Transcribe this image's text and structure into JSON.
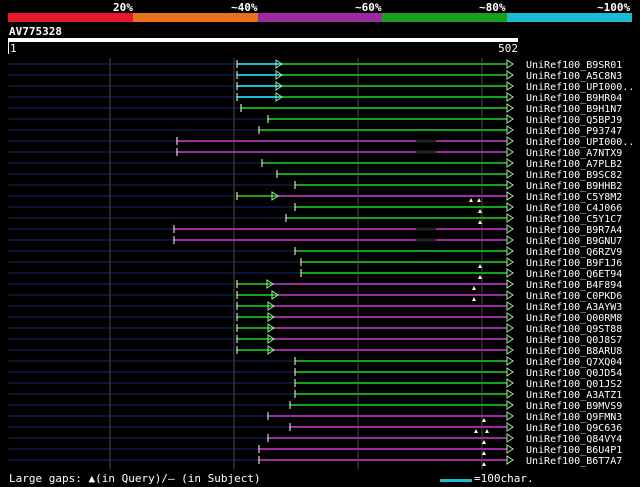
{
  "legend": {
    "labels": [
      "20%",
      "~40%",
      "~60%",
      "~80%",
      "~100%"
    ],
    "colors": [
      "#e6162b",
      "#e8711b",
      "#9c2aa0",
      "#18a01c",
      "#19bcd2"
    ]
  },
  "query": {
    "name": "AV775328",
    "start": "1",
    "end": "502"
  },
  "footer": {
    "gaps_text": "Large gaps: ▲(in Query)/– (in Subject)",
    "scale_text": "=100char."
  },
  "hits": [
    {
      "label": "UniRef100_B9SR01",
      "color": "#18a01c",
      "start": 237,
      "end": 513,
      "seg_color": "#19bcd2",
      "seg_end": 281,
      "ticks": [],
      "gaps": []
    },
    {
      "label": "UniRef100_A5C8N3",
      "color": "#18a01c",
      "start": 237,
      "end": 513,
      "seg_color": "#19bcd2",
      "seg_end": 281,
      "ticks": [],
      "gaps": []
    },
    {
      "label": "UniRef100_UPI000..",
      "color": "#18a01c",
      "start": 237,
      "end": 513,
      "seg_color": "#19bcd2",
      "seg_end": 281,
      "ticks": [],
      "gaps": []
    },
    {
      "label": "UniRef100_B9HR04",
      "color": "#18a01c",
      "start": 237,
      "end": 513,
      "seg_color": "#19bcd2",
      "seg_end": 281,
      "ticks": [],
      "gaps": []
    },
    {
      "label": "UniRef100_B9H1N7",
      "color": "#18a01c",
      "start": 241,
      "end": 513,
      "seg_color": "",
      "seg_end": 0,
      "ticks": [],
      "gaps": []
    },
    {
      "label": "UniRef100_Q5BPJ9",
      "color": "#18a01c",
      "start": 268,
      "end": 513,
      "seg_color": "",
      "seg_end": 0,
      "ticks": [],
      "gaps": []
    },
    {
      "label": "UniRef100_P93747",
      "color": "#18a01c",
      "start": 259,
      "end": 513,
      "seg_color": "",
      "seg_end": 0,
      "ticks": [],
      "gaps": []
    },
    {
      "label": "UniRef100_UPI000..",
      "color": "#9c2aa0",
      "start": 177,
      "end": 513,
      "seg_color": "",
      "seg_end": 0,
      "ticks": [],
      "gaps": [
        [
          416,
          436
        ]
      ]
    },
    {
      "label": "UniRef100_A7NTX9",
      "color": "#9c2aa0",
      "start": 177,
      "end": 513,
      "seg_color": "",
      "seg_end": 0,
      "ticks": [],
      "gaps": [
        [
          416,
          436
        ]
      ]
    },
    {
      "label": "UniRef100_A7PLB2",
      "color": "#18a01c",
      "start": 262,
      "end": 513,
      "seg_color": "",
      "seg_end": 0,
      "ticks": [],
      "gaps": []
    },
    {
      "label": "UniRef100_B9SC82",
      "color": "#18a01c",
      "start": 277,
      "end": 513,
      "seg_color": "",
      "seg_end": 0,
      "ticks": [],
      "gaps": []
    },
    {
      "label": "UniRef100_B9HHB2",
      "color": "#18a01c",
      "start": 295,
      "end": 513,
      "seg_color": "",
      "seg_end": 0,
      "ticks": [],
      "gaps": []
    },
    {
      "label": "UniRef100_C5Y8M2",
      "color": "#9c2aa0",
      "start": 237,
      "end": 513,
      "seg_color": "#18a01c",
      "seg_end": 277,
      "ticks": [
        471,
        479
      ],
      "gaps": []
    },
    {
      "label": "UniRef100_C4J066",
      "color": "#18a01c",
      "start": 295,
      "end": 513,
      "seg_color": "",
      "seg_end": 0,
      "ticks": [
        480
      ],
      "gaps": []
    },
    {
      "label": "UniRef100_C5Y1C7",
      "color": "#18a01c",
      "start": 286,
      "end": 513,
      "seg_color": "",
      "seg_end": 0,
      "ticks": [
        480
      ],
      "gaps": []
    },
    {
      "label": "UniRef100_B9R7A4",
      "color": "#9c2aa0",
      "start": 174,
      "end": 513,
      "seg_color": "",
      "seg_end": 0,
      "ticks": [],
      "gaps": [
        [
          416,
          436
        ]
      ]
    },
    {
      "label": "UniRef100_B9GNU7",
      "color": "#9c2aa0",
      "start": 174,
      "end": 513,
      "seg_color": "",
      "seg_end": 0,
      "ticks": [],
      "gaps": [
        [
          416,
          436
        ]
      ]
    },
    {
      "label": "UniRef100_Q6RZV9",
      "color": "#18a01c",
      "start": 295,
      "end": 513,
      "seg_color": "",
      "seg_end": 0,
      "ticks": [],
      "gaps": []
    },
    {
      "label": "UniRef100_B9F1J6",
      "color": "#18a01c",
      "start": 301,
      "end": 513,
      "seg_color": "",
      "seg_end": 0,
      "ticks": [
        480
      ],
      "gaps": []
    },
    {
      "label": "UniRef100_Q6ET94",
      "color": "#18a01c",
      "start": 301,
      "end": 513,
      "seg_color": "",
      "seg_end": 0,
      "ticks": [
        480
      ],
      "gaps": []
    },
    {
      "label": "UniRef100_B4F894",
      "color": "#9c2aa0",
      "start": 237,
      "end": 513,
      "seg_color": "#18a01c",
      "seg_end": 272,
      "ticks": [
        474
      ],
      "gaps": []
    },
    {
      "label": "UniRef100_C0PKD6",
      "color": "#9c2aa0",
      "start": 237,
      "end": 513,
      "seg_color": "#18a01c",
      "seg_end": 277,
      "ticks": [
        474
      ],
      "gaps": []
    },
    {
      "label": "UniRef100_A3AYW3",
      "color": "#9c2aa0",
      "start": 237,
      "end": 513,
      "seg_color": "#18a01c",
      "seg_end": 273,
      "ticks": [],
      "gaps": []
    },
    {
      "label": "UniRef100_Q00RM8",
      "color": "#9c2aa0",
      "start": 237,
      "end": 513,
      "seg_color": "#18a01c",
      "seg_end": 273,
      "ticks": [],
      "gaps": []
    },
    {
      "label": "UniRef100_Q9ST88",
      "color": "#9c2aa0",
      "start": 237,
      "end": 513,
      "seg_color": "#18a01c",
      "seg_end": 273,
      "ticks": [],
      "gaps": []
    },
    {
      "label": "UniRef100_Q0J8S7",
      "color": "#9c2aa0",
      "start": 237,
      "end": 513,
      "seg_color": "#18a01c",
      "seg_end": 273,
      "ticks": [],
      "gaps": []
    },
    {
      "label": "UniRef100_B8ARU8",
      "color": "#9c2aa0",
      "start": 237,
      "end": 513,
      "seg_color": "#18a01c",
      "seg_end": 273,
      "ticks": [],
      "gaps": []
    },
    {
      "label": "UniRef100_Q7XQ04",
      "color": "#18a01c",
      "start": 295,
      "end": 513,
      "seg_color": "",
      "seg_end": 0,
      "ticks": [],
      "gaps": []
    },
    {
      "label": "UniRef100_Q0JD54",
      "color": "#18a01c",
      "start": 295,
      "end": 513,
      "seg_color": "",
      "seg_end": 0,
      "ticks": [],
      "gaps": []
    },
    {
      "label": "UniRef100_Q01JS2",
      "color": "#18a01c",
      "start": 295,
      "end": 513,
      "seg_color": "",
      "seg_end": 0,
      "ticks": [],
      "gaps": []
    },
    {
      "label": "UniRef100_A3ATZ1",
      "color": "#18a01c",
      "start": 295,
      "end": 513,
      "seg_color": "",
      "seg_end": 0,
      "ticks": [],
      "gaps": []
    },
    {
      "label": "UniRef100_B9MVS9",
      "color": "#18a01c",
      "start": 290,
      "end": 513,
      "seg_color": "",
      "seg_end": 0,
      "ticks": [],
      "gaps": []
    },
    {
      "label": "UniRef100_Q9FMN3",
      "color": "#9c2aa0",
      "start": 268,
      "end": 513,
      "seg_color": "",
      "seg_end": 0,
      "ticks": [
        484
      ],
      "gaps": []
    },
    {
      "label": "UniRef100_Q9C636",
      "color": "#9c2aa0",
      "start": 290,
      "end": 513,
      "seg_color": "",
      "seg_end": 0,
      "ticks": [
        476,
        487
      ],
      "gaps": []
    },
    {
      "label": "UniRef100_Q84VY4",
      "color": "#9c2aa0",
      "start": 268,
      "end": 513,
      "seg_color": "",
      "seg_end": 0,
      "ticks": [
        484
      ],
      "gaps": []
    },
    {
      "label": "UniRef100_B6U4P1",
      "color": "#9c2aa0",
      "start": 259,
      "end": 513,
      "seg_color": "",
      "seg_end": 0,
      "ticks": [
        484
      ],
      "gaps": []
    },
    {
      "label": "UniRef100_B6T7A7",
      "color": "#9c2aa0",
      "start": 259,
      "end": 513,
      "seg_color": "",
      "seg_end": 0,
      "ticks": [
        484
      ],
      "gaps": []
    }
  ]
}
